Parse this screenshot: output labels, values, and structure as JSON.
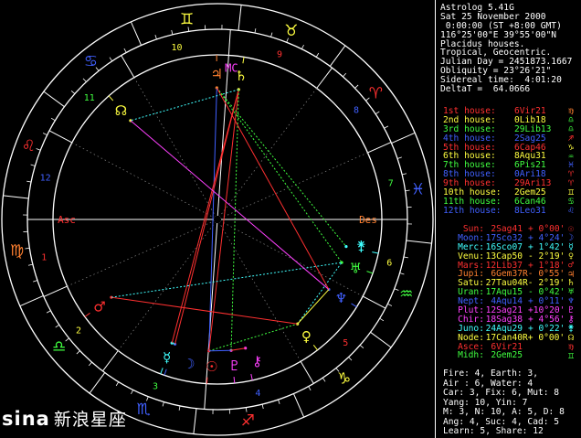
{
  "header": {
    "lines": [
      "Astrolog 5.41G",
      "Sat 25 November 2000",
      " 0:00:00 (ST +8:00 GMT)",
      "116°25'00\"E 39°55'00\"N",
      "Placidus houses.",
      "Tropical, Geocentric.",
      "Julian Day = 2451873.1667",
      "Obliquity = 23°26'21\"",
      "Sidereal time:  4:01:20",
      "DeltaT =  64.0666"
    ]
  },
  "houses": [
    {
      "label": "1st house:",
      "value": "6Vir21",
      "color": "#ff3030"
    },
    {
      "label": "2nd house:",
      "value": "0Lib18",
      "color": "#ffff40"
    },
    {
      "label": "3rd house:",
      "value": "29Lib13",
      "color": "#40ff40"
    },
    {
      "label": "4th house:",
      "value": "2Sag25",
      "color": "#4060ff"
    },
    {
      "label": "5th house:",
      "value": "6Cap46",
      "color": "#ff3030"
    },
    {
      "label": "6th house:",
      "value": "8Aqu31",
      "color": "#ffff40"
    },
    {
      "label": "7th house:",
      "value": "6Pis21",
      "color": "#40ff40"
    },
    {
      "label": "8th house:",
      "value": "0Ari18",
      "color": "#4060ff"
    },
    {
      "label": "9th house:",
      "value": "29Ari13",
      "color": "#ff3030"
    },
    {
      "label": "10th house:",
      "value": "2Gem25",
      "color": "#ffff40"
    },
    {
      "label": "11th house:",
      "value": "6Can46",
      "color": "#40ff40"
    },
    {
      "label": "12th house:",
      "value": "8Leo31",
      "color": "#4060ff"
    }
  ],
  "house_signs": [
    {
      "glyph": "♍",
      "color": "#ff8030"
    },
    {
      "glyph": "♎",
      "color": "#40ff40"
    },
    {
      "glyph": "♎",
      "color": "#40ff40"
    },
    {
      "glyph": "♐",
      "color": "#ff3030"
    },
    {
      "glyph": "♑",
      "color": "#ffff40"
    },
    {
      "glyph": "♒",
      "color": "#40ff40"
    },
    {
      "glyph": "♓",
      "color": "#4060ff"
    },
    {
      "glyph": "♈",
      "color": "#ff3030"
    },
    {
      "glyph": "♈",
      "color": "#ff3030"
    },
    {
      "glyph": "♊",
      "color": "#ffff40"
    },
    {
      "glyph": "♋",
      "color": "#40ff40"
    },
    {
      "glyph": "♌",
      "color": "#4060ff"
    }
  ],
  "planets": [
    {
      "name": "Sun:",
      "pos": "2Sag41",
      "retro": "",
      "lat": "+ 0°00'",
      "color": "#ff3030",
      "glyph": "☉"
    },
    {
      "name": "Moon:",
      "pos": "17Sco32",
      "retro": "",
      "lat": "+ 4°24'",
      "color": "#4060ff",
      "glyph": "☽"
    },
    {
      "name": "Merc:",
      "pos": "16Sco07",
      "retro": "",
      "lat": "+ 1°42'",
      "color": "#40ffff",
      "glyph": "☿"
    },
    {
      "name": "Venu:",
      "pos": "13Cap50",
      "retro": "",
      "lat": "- 2°19'",
      "color": "#ffff40",
      "glyph": "♀"
    },
    {
      "name": "Mars:",
      "pos": "12Lib37",
      "retro": "",
      "lat": "+ 1°18'",
      "color": "#ff3030",
      "glyph": "♂"
    },
    {
      "name": "Jupi:",
      "pos": "6Gem37",
      "retro": "R",
      "lat": "- 0°55'",
      "color": "#ff8030",
      "glyph": "♃"
    },
    {
      "name": "Satu:",
      "pos": "27Tau04",
      "retro": "R",
      "lat": "- 2°19'",
      "color": "#ffff40",
      "glyph": "♄"
    },
    {
      "name": "Uran:",
      "pos": "17Aqu15",
      "retro": "",
      "lat": "- 0°42'",
      "color": "#40ff40",
      "glyph": "♅"
    },
    {
      "name": "Nept:",
      "pos": "4Aqu14",
      "retro": "",
      "lat": "+ 0°11'",
      "color": "#4060ff",
      "glyph": "♆"
    },
    {
      "name": "Plut:",
      "pos": "12Sag21",
      "retro": "",
      "lat": "+10°20'",
      "color": "#ff40ff",
      "glyph": "♇"
    },
    {
      "name": "Chir:",
      "pos": "18Sag38",
      "retro": "",
      "lat": "+ 4°56'",
      "color": "#ff40ff",
      "glyph": "⚷"
    },
    {
      "name": "Juno:",
      "pos": "24Aqu29",
      "retro": "",
      "lat": "+ 0°22'",
      "color": "#40ffff",
      "glyph": "⚵"
    },
    {
      "name": "Node:",
      "pos": "17Can40",
      "retro": "R",
      "lat": "+ 0°00'",
      "color": "#ffff40",
      "glyph": "☊"
    },
    {
      "name": "Asce:",
      "pos": "6Vir21",
      "retro": "",
      "lat": "",
      "color": "#ff3030",
      "glyph": "♍"
    },
    {
      "name": "Midh:",
      "pos": "2Gem25",
      "retro": "",
      "lat": "",
      "color": "#40ff40",
      "glyph": "♊"
    }
  ],
  "stats": [
    "Fire: 4, Earth: 3,",
    "Air : 6, Water: 4",
    "Car: 3, Fix: 6, Mut: 8",
    "Yang: 10, Yin: 7",
    "M: 3, N: 10, A: 5, D: 8",
    "Ang: 4, Suc: 4, Cad: 5",
    "Learn: 5, Share: 12"
  ],
  "wheel": {
    "asc_label": "Asc",
    "des_label": "Des",
    "mc_label": "MC",
    "house_numbers": [
      "1",
      "2",
      "3",
      "4",
      "5",
      "6",
      "7",
      "8",
      "9",
      "10",
      "11",
      "12"
    ]
  },
  "watermark": {
    "brand": "sina",
    "text": "新浪星座"
  }
}
